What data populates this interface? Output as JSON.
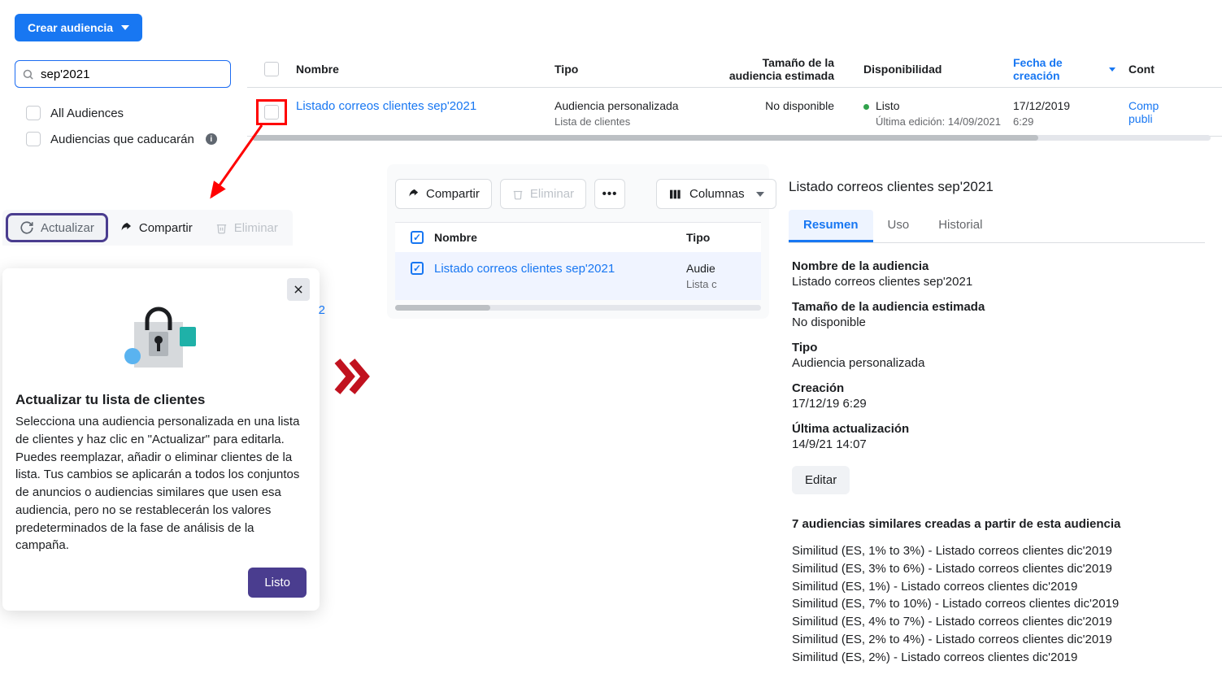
{
  "create_button": "Crear audiencia",
  "search": {
    "value": "sep'2021"
  },
  "filters": {
    "all": "All Audiences",
    "expiring": "Audiencias que caducarán"
  },
  "table": {
    "headers": {
      "name": "Nombre",
      "type": "Tipo",
      "size": "Tamaño de la audiencia estimada",
      "availability": "Disponibilidad",
      "created": "Fecha de creación",
      "cont": "Cont"
    },
    "row": {
      "name": "Listado correos clientes sep'2021",
      "type": "Audiencia personalizada",
      "type_sub": "Lista de clientes",
      "size": "No disponible",
      "availability": "Listo",
      "availability_sub": "Última edición: 14/09/2021",
      "created": "17/12/2019",
      "created_sub": "6:29",
      "cont": "Comp",
      "cont_sub": "publi"
    }
  },
  "toolbar1": {
    "update": "Actualizar",
    "share": "Compartir",
    "delete": "Eliminar"
  },
  "popup": {
    "truncated_num": "2",
    "title": "Actualizar tu lista de clientes",
    "body": "Selecciona una audiencia personalizada en una lista de clientes y haz clic en \"Actualizar\" para editarla. Puedes reemplazar, añadir o eliminar clientes de la lista. Tus cambios se aplicarán a todos los conjuntos de anuncios o audiencias similares que usen esa audiencia, pero no se restablecerán los valores predeterminados de la fase de análisis de la campaña.",
    "done": "Listo"
  },
  "toolbar2": {
    "share": "Compartir",
    "delete": "Eliminar",
    "columns": "Columnas"
  },
  "table2": {
    "headers": {
      "name": "Nombre",
      "type": "Tipo"
    },
    "row": {
      "name": "Listado correos clientes sep'2021",
      "type": "Audie",
      "type_sub": "Lista c"
    }
  },
  "detail": {
    "title": "Listado correos clientes sep'2021",
    "tabs": {
      "summary": "Resumen",
      "usage": "Uso",
      "history": "Historial"
    },
    "name_label": "Nombre de la audiencia",
    "name_value": "Listado correos clientes sep'2021",
    "size_label": "Tamaño de la audiencia estimada",
    "size_value": "No disponible",
    "type_label": "Tipo",
    "type_value": "Audiencia personalizada",
    "created_label": "Creación",
    "created_value": "17/12/19 6:29",
    "updated_label": "Última actualización",
    "updated_value": "14/9/21 14:07",
    "edit": "Editar",
    "similar_title": "7 audiencias similares creadas a partir de esta audiencia",
    "similar": [
      "Similitud (ES, 1% to 3%) - Listado correos clientes dic'2019",
      "Similitud (ES, 3% to 6%) - Listado correos clientes dic'2019",
      "Similitud (ES, 1%) - Listado correos clientes dic'2019",
      "Similitud (ES, 7% to 10%) - Listado correos clientes dic'2019",
      "Similitud (ES, 4% to 7%) - Listado correos clientes dic'2019",
      "Similitud (ES, 2% to 4%) - Listado correos clientes dic'2019",
      "Similitud (ES, 2%) - Listado correos clientes dic'2019"
    ]
  }
}
